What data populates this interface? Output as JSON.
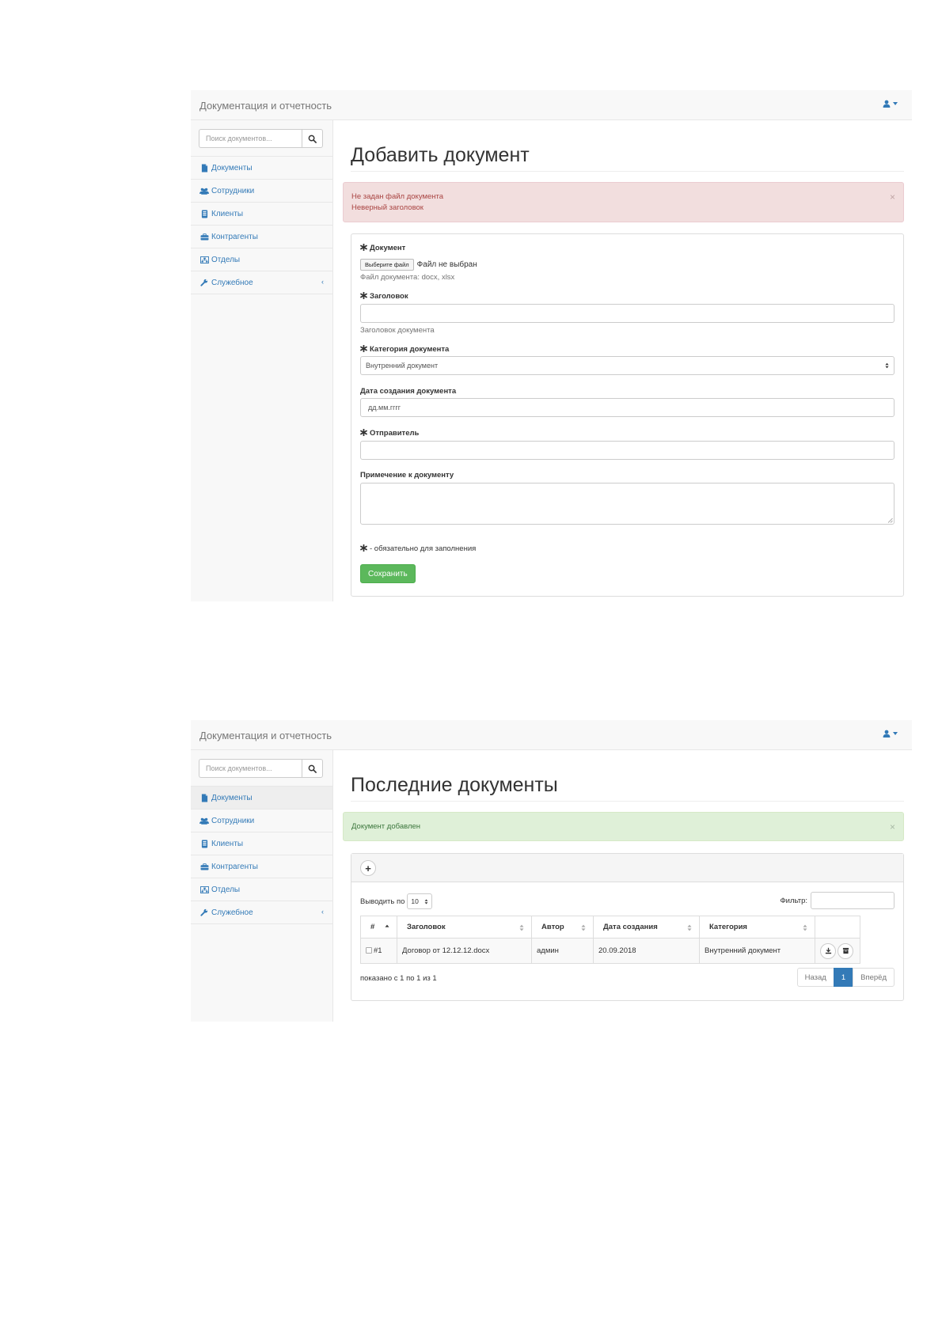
{
  "colors": {
    "link": "#337ab7",
    "danger_bg": "#f2dede",
    "danger_text": "#a94442",
    "success_bg": "#dff0d8",
    "success_text": "#3c763d",
    "save_button": "#5cb85c",
    "pagination_active": "#337ab7"
  },
  "app": {
    "brand": "Документация и отчетность",
    "user_icon": "user-icon"
  },
  "sidebar": {
    "search_placeholder": "Поиск документов...",
    "items": [
      {
        "label": "Документы",
        "icon": "file-icon"
      },
      {
        "label": "Сотрудники",
        "icon": "users-icon"
      },
      {
        "label": "Клиенты",
        "icon": "book-icon"
      },
      {
        "label": "Контрагенты",
        "icon": "briefcase-icon"
      },
      {
        "label": "Отделы",
        "icon": "sitemap-icon"
      },
      {
        "label": "Служебное",
        "icon": "wrench-icon"
      }
    ]
  },
  "add_form": {
    "title": "Добавить документ",
    "alert_lines": [
      "Не задан файл документа",
      "Неверный заголовок"
    ],
    "document_label": "Документ",
    "file_button": "Выберите файл",
    "file_status": "Файл не выбран",
    "file_help": "Файл документа: docx, xlsx",
    "title_label": "Заголовок",
    "title_value": "",
    "title_help": "Заголовок документа",
    "category_label": "Категория документа",
    "category_value": "Внутренний документ",
    "date_label": "Дата создания документа",
    "date_placeholder": "дд.мм.гггг",
    "sender_label": "Отправитель",
    "sender_value": "",
    "note_label": "Примечение к документу",
    "note_value": "",
    "required_note": "- обязательно для заполнения",
    "save_label": "Сохранить"
  },
  "list": {
    "title": "Последние документы",
    "alert": "Документ добавлен",
    "add_label": "+",
    "length_prefix": "Выводить по",
    "length_value": "10",
    "filter_label": "Фильтр:",
    "columns": [
      "#",
      "Заголовок",
      "Автор",
      "Дата создания",
      "Категория"
    ],
    "rows": [
      {
        "id": "#1",
        "title": "Договор от 12.12.12.docx",
        "author": "админ",
        "date": "20.09.2018",
        "category": "Внутренний документ"
      }
    ],
    "info": "показано с 1 по 1 из 1",
    "pagination": {
      "prev": "Назад",
      "current": "1",
      "next": "Вперёд"
    }
  }
}
